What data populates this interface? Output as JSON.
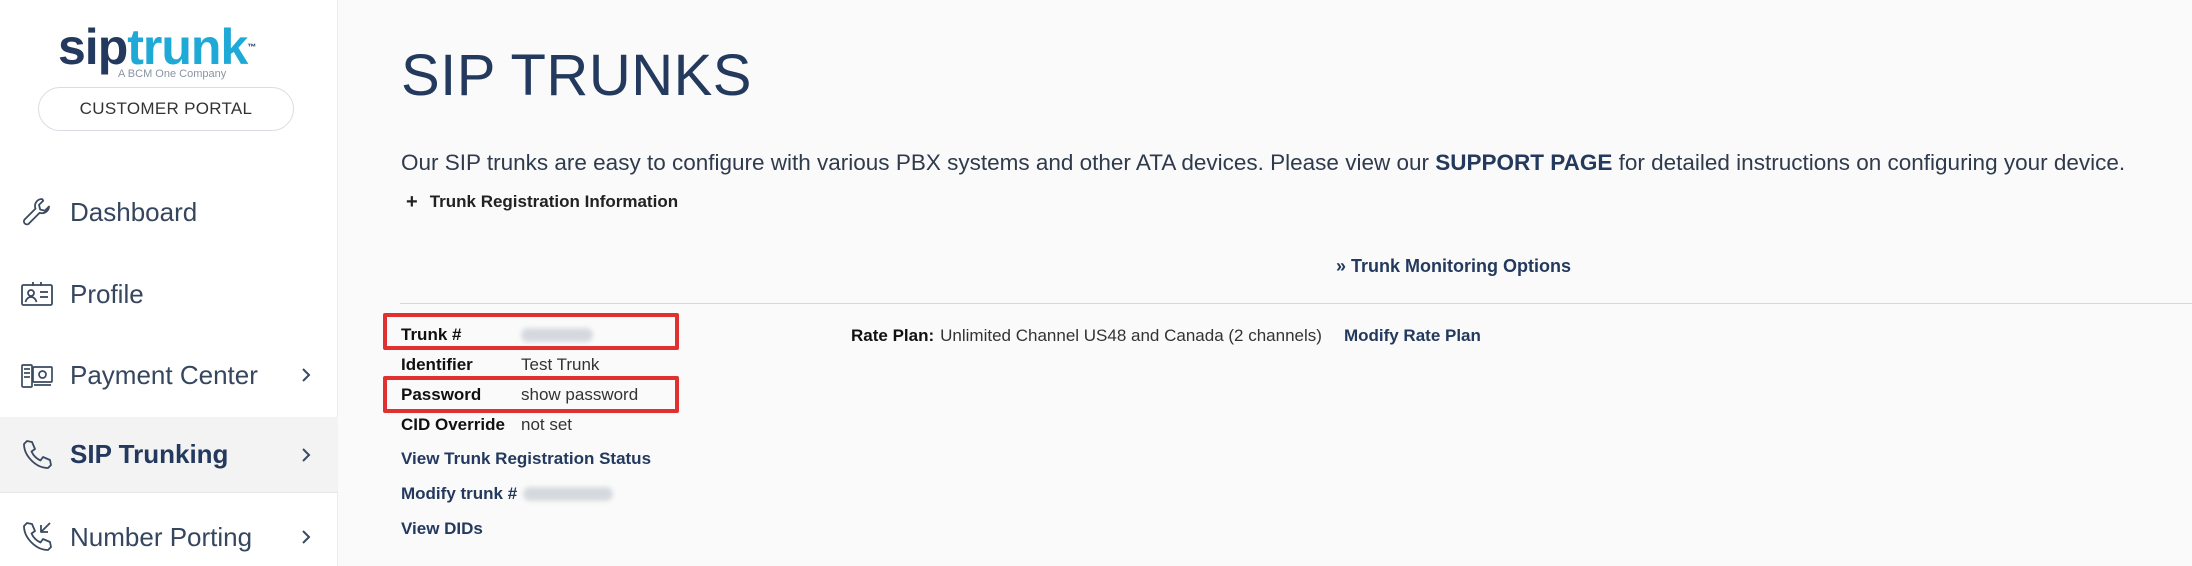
{
  "brand": {
    "logo_part1": "sip",
    "logo_part2": "trunk",
    "logo_tm": "™",
    "tagline": "A BCM One Company",
    "portal_label": "CUSTOMER PORTAL",
    "colors": {
      "navy": "#23395d",
      "cyan": "#1fa9d6"
    }
  },
  "sidebar": {
    "items": [
      {
        "label": "Dashboard",
        "icon": "wrench-icon",
        "has_chevron": false
      },
      {
        "label": "Profile",
        "icon": "id-card-icon",
        "has_chevron": false
      },
      {
        "label": "Payment Center",
        "icon": "payment-icon",
        "has_chevron": true
      },
      {
        "label": "SIP Trunking",
        "icon": "phone-icon",
        "has_chevron": true,
        "active": true
      },
      {
        "label": "Number Porting",
        "icon": "phone-incoming-icon",
        "has_chevron": true
      }
    ]
  },
  "main": {
    "title": "SIP TRUNKS",
    "intro_before": "Our SIP trunks are easy to configure with various PBX systems and other ATA devices. Please view our ",
    "intro_link": "SUPPORT PAGE",
    "intro_after": " for detailed instructions on configuring your device.",
    "reg_info_plus": "+",
    "reg_info_label": "Trunk Registration Information",
    "monitoring_link": "» Trunk Monitoring Options",
    "fields": {
      "trunk_label": "Trunk #",
      "identifier_label": "Identifier",
      "identifier_value": "Test Trunk",
      "password_label": "Password",
      "password_value": "show password",
      "cid_label": "CID Override",
      "cid_value": "not set"
    },
    "links": {
      "view_reg_status": "View Trunk Registration Status",
      "modify_trunk": "Modify trunk #",
      "view_dids": "View DIDs"
    },
    "rate_plan": {
      "label": "Rate Plan:",
      "value": "Unlimited Channel US48 and Canada (2 channels)",
      "modify_label": "Modify Rate Plan"
    },
    "highlight_color": "#e0302f"
  }
}
